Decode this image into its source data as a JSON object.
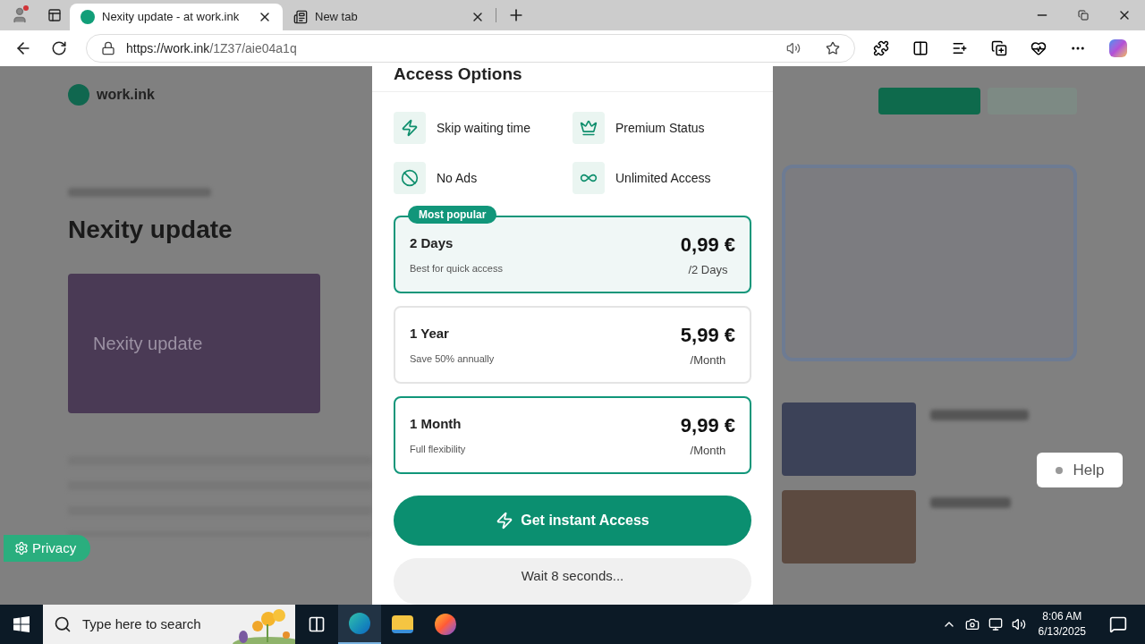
{
  "browser": {
    "tabs": [
      {
        "title": "Nexity update - at work.ink",
        "selected": true
      },
      {
        "title": "New tab",
        "selected": false
      }
    ],
    "url": {
      "host": "https://work.ink",
      "path": "/1Z37/aie04a1q"
    }
  },
  "page": {
    "logo": "work.ink",
    "title": "Nexity update",
    "card_title": "Nexity update",
    "privacy": "Privacy",
    "help": "Help"
  },
  "modal": {
    "title": "Access Options",
    "features": [
      {
        "kind": "bolt",
        "label": "Skip waiting time"
      },
      {
        "kind": "crown",
        "label": "Premium Status"
      },
      {
        "kind": "ban",
        "label": "No Ads"
      },
      {
        "kind": "infinity",
        "label": "Unlimited Access"
      }
    ],
    "plans": [
      {
        "name": "2 Days",
        "note": "Best for quick access",
        "price": "0,99 €",
        "period": "/2 Days",
        "badge": "Most popular",
        "selected": true,
        "highlighted": true
      },
      {
        "name": "1 Year",
        "note": "Save 50% annually",
        "price": "5,99 €",
        "period": "/Month",
        "selected": false,
        "highlighted": false
      },
      {
        "name": "1 Month",
        "note": "Full flexibility",
        "price": "9,99 €",
        "period": "/Month",
        "selected": false,
        "highlighted": true
      }
    ],
    "primary_button": "Get instant Access",
    "wait_button": "Wait 8 seconds..."
  },
  "taskbar": {
    "search_placeholder": "Type here to search",
    "time": "8:06 AM",
    "date": "6/13/2025"
  }
}
